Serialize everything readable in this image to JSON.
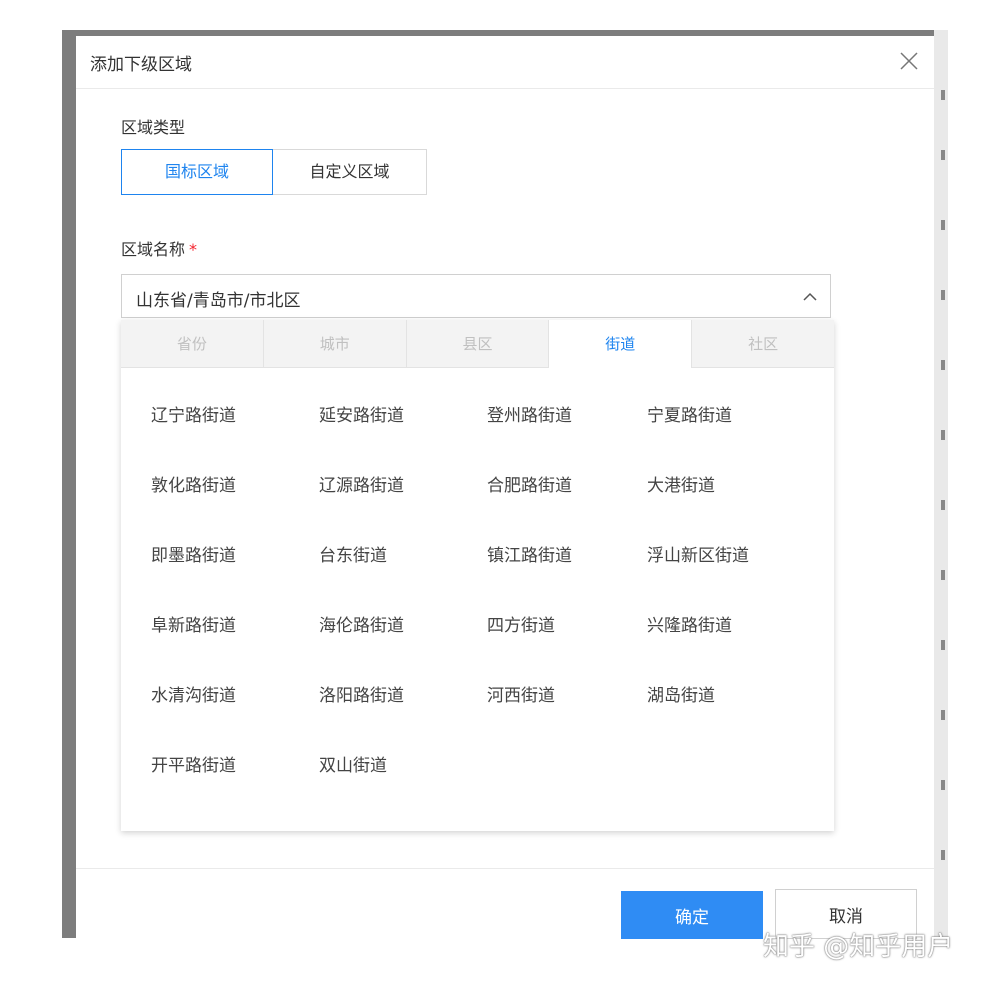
{
  "modal": {
    "title": "添加下级区域"
  },
  "region_type": {
    "label": "区域类型",
    "options": [
      "国标区域",
      "自定义区域"
    ],
    "selected": "国标区域"
  },
  "region_name": {
    "label": "区域名称",
    "required_mark": "*",
    "value": "山东省/青岛市/市北区"
  },
  "dropdown": {
    "tabs": [
      "省份",
      "城市",
      "县区",
      "街道",
      "社区"
    ],
    "active_tab": "街道",
    "items": [
      "辽宁路街道",
      "延安路街道",
      "登州路街道",
      "宁夏路街道",
      "敦化路街道",
      "辽源路街道",
      "合肥路街道",
      "大港街道",
      "即墨路街道",
      "台东街道",
      "镇江路街道",
      "浮山新区街道",
      "阜新路街道",
      "海伦路街道",
      "四方街道",
      "兴隆路街道",
      "水清沟街道",
      "洛阳路街道",
      "河西街道",
      "湖岛街道",
      "开平路街道",
      "双山街道"
    ]
  },
  "footer": {
    "ok_label": "确定",
    "cancel_label": "取消"
  },
  "watermark": "知乎 @知乎用户",
  "colors": {
    "accent": "#1e84ef",
    "primary_button": "#2f8cf4",
    "required": "#f5222d"
  }
}
